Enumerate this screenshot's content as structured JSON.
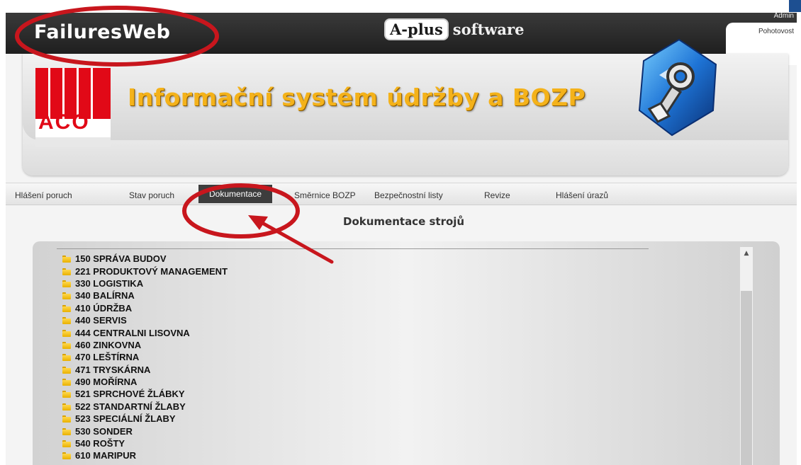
{
  "app": {
    "title": "FailuresWeb",
    "brand_box": "A-plus",
    "brand_word": "software",
    "headline": "Informační systém údržby a BOZP",
    "logo_text": "ACO"
  },
  "user_menu": {
    "admin_label": "Admin",
    "standby_label": "Pohotovost"
  },
  "nav": {
    "items": [
      {
        "label": "Hlášení poruch"
      },
      {
        "label": "Stav poruch"
      },
      {
        "label": "Dokumentace"
      },
      {
        "label": "Směrnice BOZP"
      },
      {
        "label": "Bezpečnostní listy"
      },
      {
        "label": "Revize"
      },
      {
        "label": "Hlášení úrazů"
      }
    ],
    "active": "Dokumentace"
  },
  "main": {
    "title": "Dokumentace strojů",
    "tree": [
      "150 SPRÁVA BUDOV",
      "221 PRODUKTOVÝ MANAGEMENT",
      "330 LOGISTIKA",
      "340 BALÍRNA",
      "410 ÚDRŽBA",
      "440 SERVIS",
      "444 CENTRALNI LISOVNA",
      "460 ZINKOVNA",
      "470 LEŠTÍRNA",
      "471 TRYSKÁRNA",
      "490 MOŘÍRNA",
      "521 SPRCHOVÉ ŽLÁBKY",
      "522 STANDARTNÍ ŽLABY",
      "523 SPECIÁLNÍ ŽLABY",
      "530 SONDER",
      "540 ROŠTY",
      "610 MARIPUR"
    ]
  },
  "colors": {
    "annotation": "#c8161d",
    "headline": "#f4b21a",
    "aco_red": "#e10917",
    "nav_active": "#3d3d3d"
  }
}
